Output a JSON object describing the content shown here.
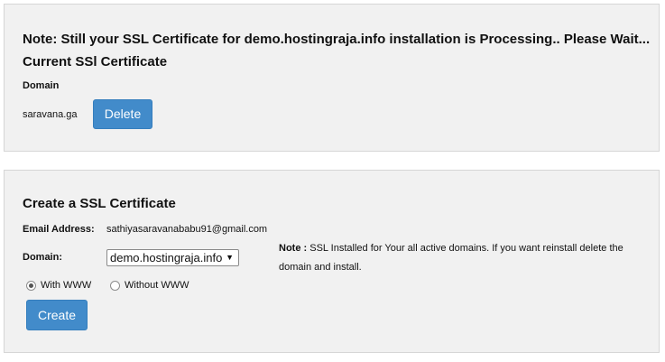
{
  "current_panel": {
    "note": "Note: Still your SSL Certificate for demo.hostingraja.info installation is Processing.. Please Wait...",
    "heading": "Current SSl Certificate",
    "domain_label": "Domain",
    "domain_value": "saravana.ga",
    "delete_label": "Delete"
  },
  "create_panel": {
    "heading": "Create a SSL Certificate",
    "email_label": "Email Address:",
    "email_value": "sathiyasaravanababu91@gmail.com",
    "domain_label": "Domain:",
    "domain_selected": "demo.hostingraja.info",
    "note_label": "Note :",
    "note_text": " SSL Installed for Your all active domains. If you want reinstall delete the domain and install.",
    "radio_with_www": "With WWW",
    "radio_without_www": "Without WWW",
    "radio_selected": "With WWW",
    "create_label": "Create"
  },
  "colors": {
    "button_primary": "#428bca",
    "panel_background": "#f1f1f1",
    "panel_border": "#d6d6d6"
  }
}
